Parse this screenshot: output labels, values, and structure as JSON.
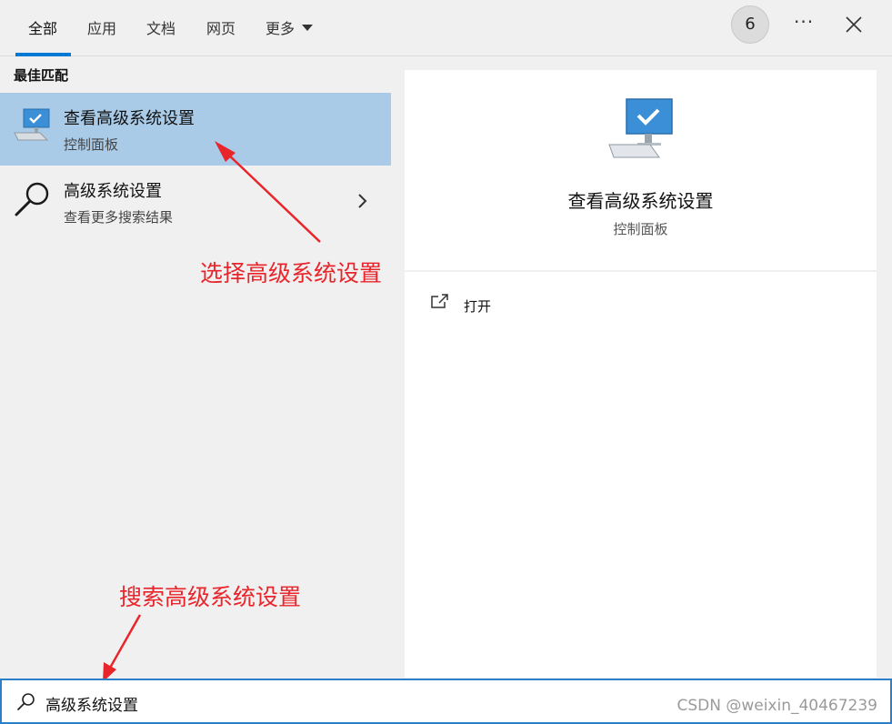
{
  "tabs": [
    {
      "label": "全部",
      "active": true
    },
    {
      "label": "应用"
    },
    {
      "label": "文档"
    },
    {
      "label": "网页"
    },
    {
      "label": "更多"
    }
  ],
  "header": {
    "badge_count": "6",
    "more_options": "···"
  },
  "results": {
    "section_label": "最佳匹配",
    "items": [
      {
        "title": "查看高级系统设置",
        "subtitle": "控制面板",
        "icon": "computer-icon"
      },
      {
        "title": "高级系统设置",
        "subtitle": "查看更多搜索结果",
        "icon": "search-icon"
      }
    ]
  },
  "detail": {
    "title": "查看高级系统设置",
    "subtitle": "控制面板",
    "actions": [
      {
        "label": "打开",
        "icon": "open-icon"
      }
    ]
  },
  "annotations": {
    "select": "选择高级系统设置",
    "search": "搜索高级系统设置"
  },
  "search": {
    "value": "高级系统设置"
  },
  "watermark": "CSDN @weixin_40467239",
  "colors": {
    "accent": "#0078d4",
    "selected_bg": "#a9cbe8",
    "annotation": "#e8252b"
  }
}
